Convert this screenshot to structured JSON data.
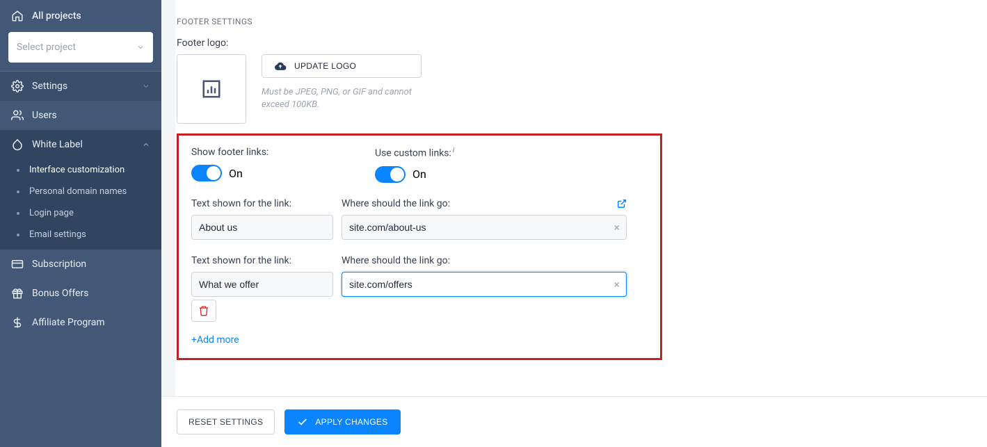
{
  "sidebar": {
    "all_projects": "All projects",
    "select_placeholder": "Select project",
    "settings": "Settings",
    "users": "Users",
    "white_label": "White Label",
    "subitems": [
      "Interface customization",
      "Personal domain names",
      "Login page",
      "Email settings"
    ],
    "subscription": "Subscription",
    "bonus_offers": "Bonus Offers",
    "affiliate": "Affiliate Program"
  },
  "main": {
    "section_title": "FOOTER SETTINGS",
    "footer_logo_label": "Footer logo:",
    "update_logo": "UPDATE LOGO",
    "logo_hint": "Must be JPEG, PNG, or GIF and cannot exceed 100KB.",
    "show_links_label": "Show footer links:",
    "use_custom_label": "Use custom links:",
    "toggle_state": "On",
    "text_label": "Text shown for the link:",
    "url_label": "Where should the link go:",
    "links": [
      {
        "text": "About us",
        "url": "site.com/about-us"
      },
      {
        "text": "What we offer",
        "url": "site.com/offers"
      }
    ],
    "add_more": "+Add more",
    "reset": "RESET SETTINGS",
    "apply": "APPLY CHANGES"
  }
}
